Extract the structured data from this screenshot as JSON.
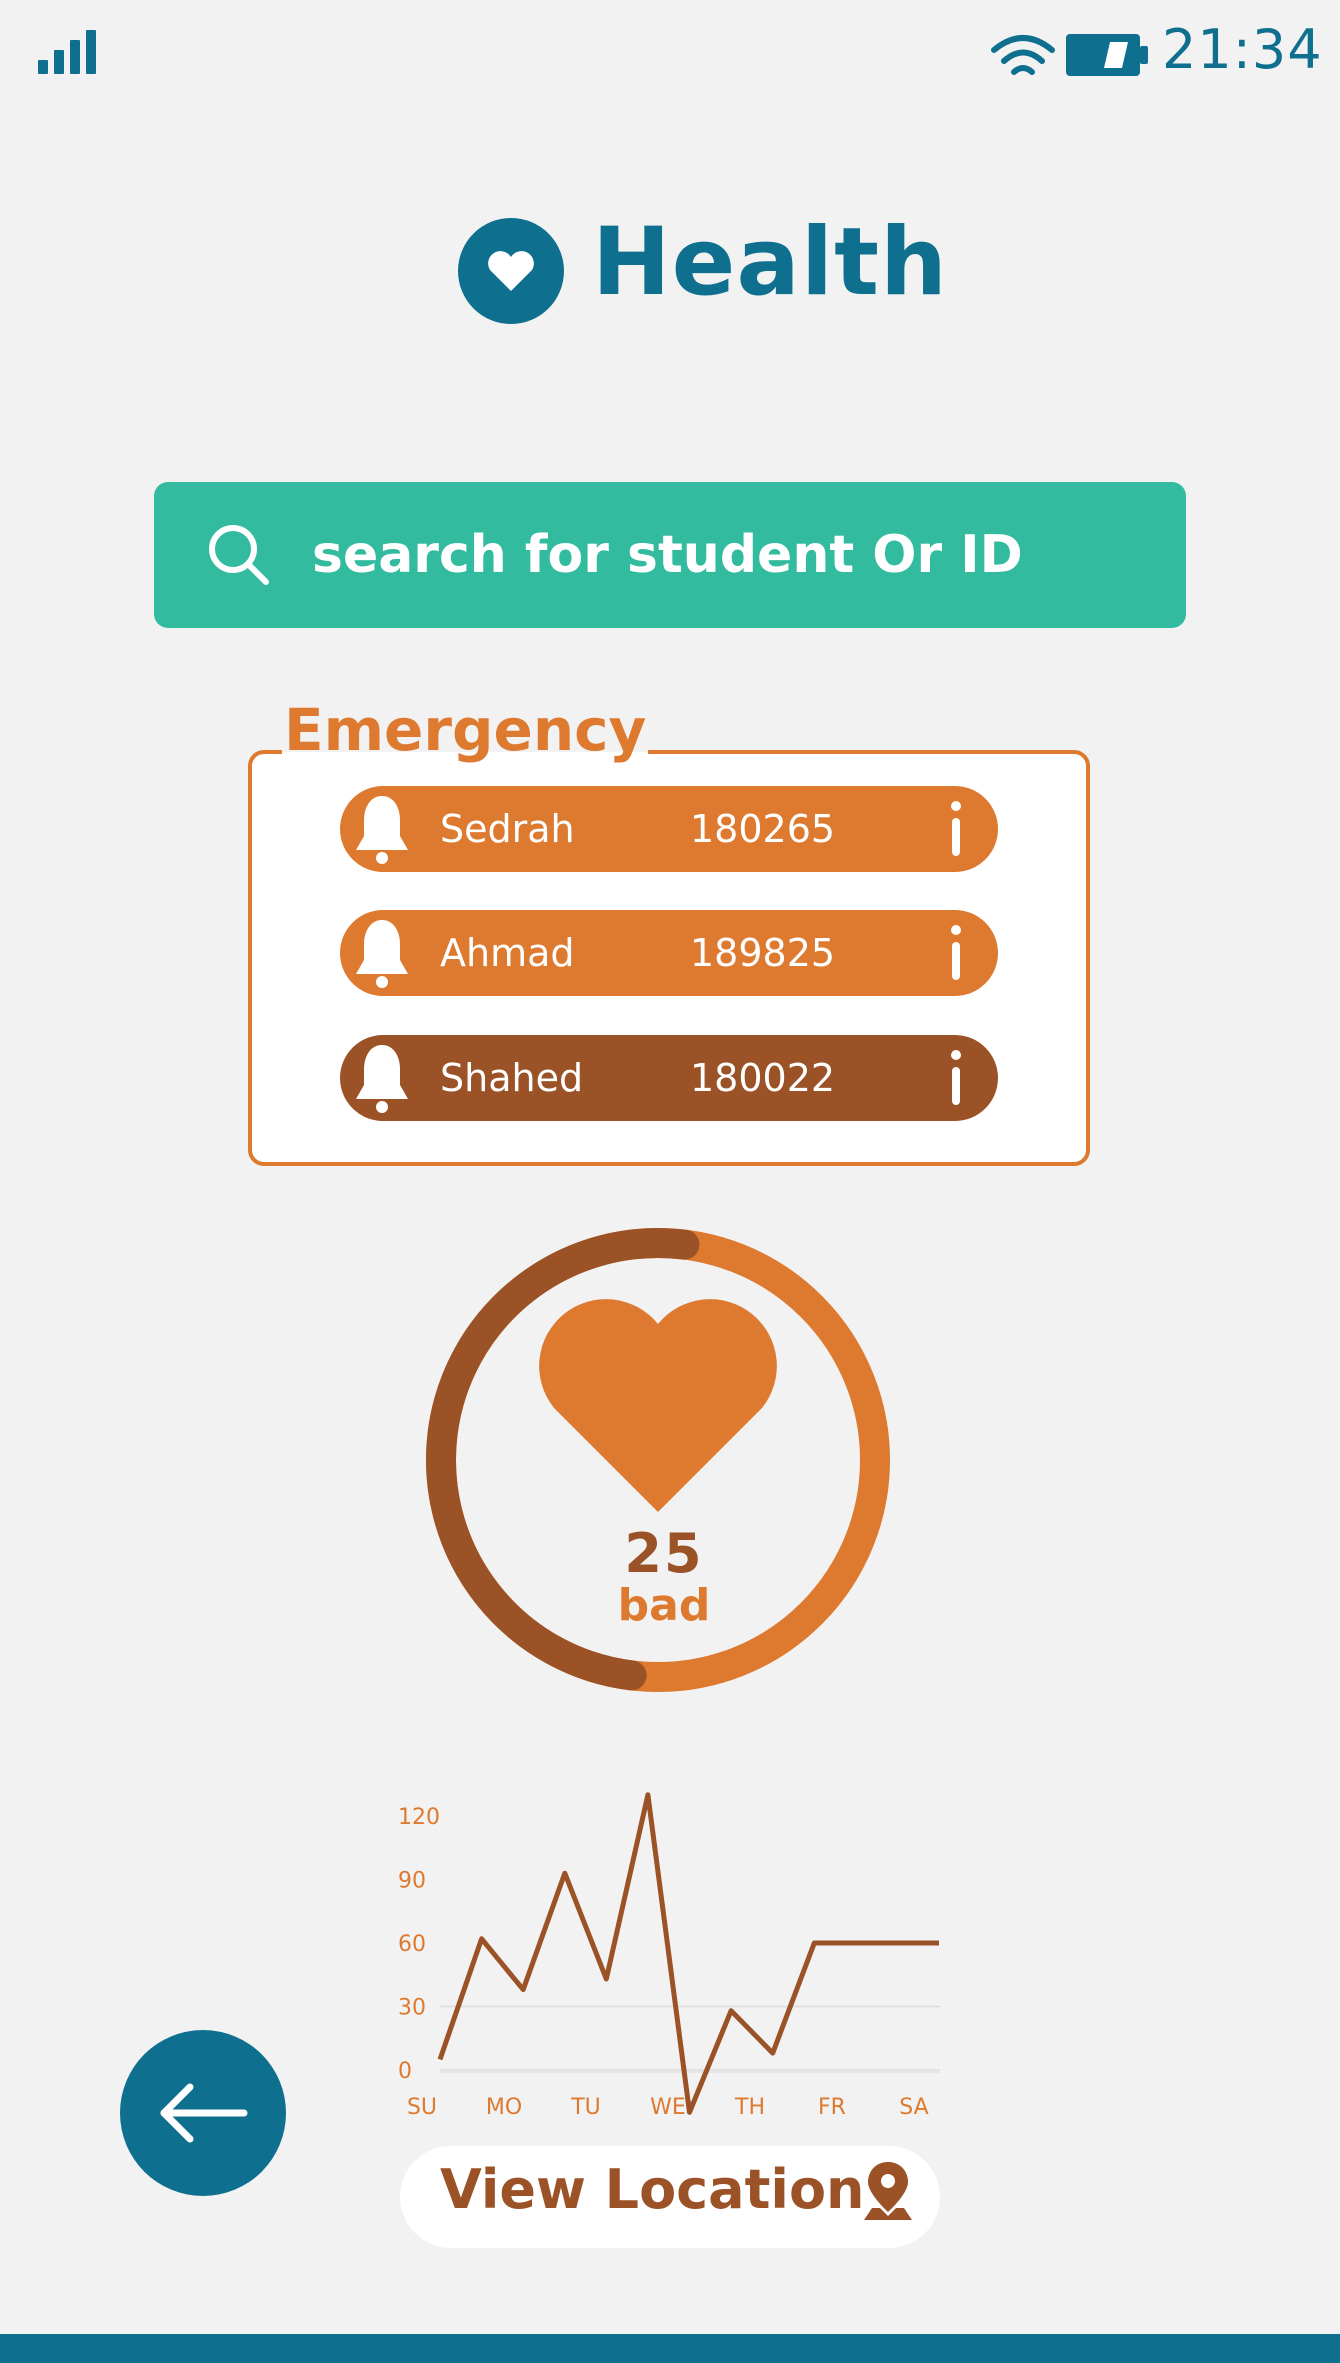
{
  "status_bar": {
    "time": "21:34",
    "icons": [
      "signal-icon",
      "wifi-icon",
      "battery-icon"
    ]
  },
  "header": {
    "title": "Health",
    "logo_icon": "heart-icon"
  },
  "search": {
    "placeholder": "search for student Or ID",
    "icon": "search-icon"
  },
  "emergency": {
    "title": "Emergency",
    "items": [
      {
        "name": "Sedrah",
        "id": "180265",
        "color": "#dd7a30"
      },
      {
        "name": "Ahmad",
        "id": "189825",
        "color": "#dd7a30"
      },
      {
        "name": "Shahed",
        "id": "180022",
        "color": "#9b5226"
      }
    ]
  },
  "gauge": {
    "value": "25",
    "status": "bad",
    "fraction": 0.5
  },
  "chart_data": {
    "type": "line",
    "categories": [
      "SU",
      "MO",
      "TU",
      "WE",
      "TH",
      "FR",
      "SA"
    ],
    "yticks": [
      "120",
      "90",
      "60",
      "30",
      "0"
    ],
    "ylim": [
      0,
      120
    ],
    "series": [
      {
        "values": [
          5,
          62,
          38,
          93,
          43,
          130,
          -20,
          28,
          8,
          60,
          60,
          60,
          60
        ]
      }
    ],
    "grid": "horizontal",
    "color": "#9b5226"
  },
  "actions": {
    "view_location": "View Location",
    "back_icon": "arrow-left-icon",
    "location_icon": "map-pin-icon"
  },
  "colors": {
    "primary": "#0f6f8f",
    "accent": "#33bba0",
    "orange": "#dd7a30",
    "brown": "#9b5226",
    "background": "#f2f2f2"
  }
}
